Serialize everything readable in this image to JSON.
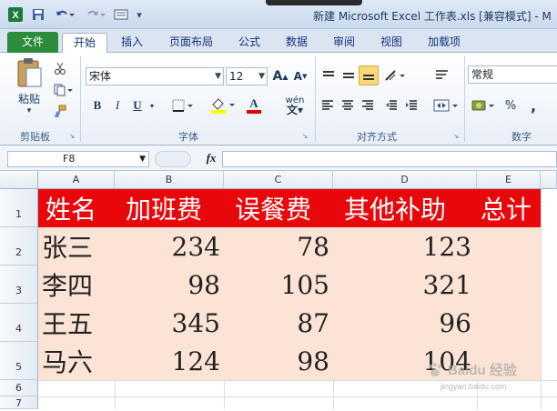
{
  "window": {
    "title": "新建 Microsoft Excel 工作表.xls  [兼容模式]  -  M"
  },
  "ribbon_tabs": [
    "文件",
    "开始",
    "插入",
    "页面布局",
    "公式",
    "数据",
    "审阅",
    "视图",
    "加载项"
  ],
  "clipboard": {
    "paste_label": "粘贴",
    "group_label": "剪贴板"
  },
  "font": {
    "name": "宋体",
    "size": "12",
    "group_label": "字体",
    "bold": "B",
    "italic": "I",
    "underline": "U",
    "color_letter": "A",
    "wen": "wén"
  },
  "alignment": {
    "group_label": "对齐方式"
  },
  "number": {
    "format": "常规",
    "group_label": "数字",
    "percent": "%"
  },
  "formula_bar": {
    "cell_ref": "F8",
    "fx": "fx",
    "value": ""
  },
  "columns": [
    "A",
    "B",
    "C",
    "D",
    "E"
  ],
  "rows": [
    "1",
    "2",
    "3",
    "4",
    "5",
    "6",
    "7"
  ],
  "sheet": {
    "header": [
      "姓名",
      "加班费",
      "误餐费",
      "其他补助",
      "总计"
    ],
    "data": [
      [
        "张三",
        "234",
        "78",
        "123",
        ""
      ],
      [
        "李四",
        "98",
        "105",
        "321",
        ""
      ],
      [
        "王五",
        "345",
        "87",
        "96",
        ""
      ],
      [
        "马六",
        "124",
        "98",
        "104",
        ""
      ]
    ]
  },
  "colors": {
    "header_fill": "#e8070b",
    "data_fill": "#fbe4d6",
    "file_tab": "#2a8c3c"
  },
  "watermark": {
    "text": "Baidu 经验",
    "sub": "jingyan.baidu.com"
  }
}
